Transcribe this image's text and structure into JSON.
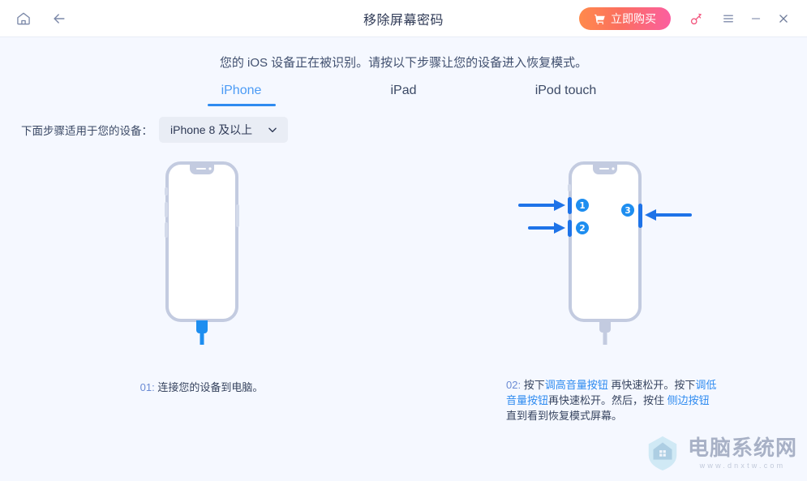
{
  "window": {
    "title": "移除屏幕密码",
    "home_icon": "home-icon",
    "back_icon": "back-arrow-icon",
    "buy_label": "立即购买",
    "cart_icon": "cart-icon",
    "key_icon": "key-icon",
    "menu_icon": "hamburger-menu-icon",
    "minimize_icon": "minimize-icon",
    "close_icon": "close-icon"
  },
  "main": {
    "subtitle": "您的 iOS 设备正在被识别。请按以下步骤让您的设备进入恢复模式。",
    "tabs": [
      {
        "label": "iPhone",
        "active": true
      },
      {
        "label": "iPad",
        "active": false
      },
      {
        "label": "iPod touch",
        "active": false
      }
    ],
    "select_label": "下面步骤适用于您的设备：",
    "select_value": "iPhone 8 及以上",
    "select_chevron": "chevron-down-icon"
  },
  "steps": [
    {
      "number": "01:",
      "text": "连接您的设备到电脑。",
      "device_image": "iphone-with-lightning-cable"
    },
    {
      "number": "02:",
      "text_parts": [
        {
          "t": "按下",
          "hl": false
        },
        {
          "t": "调高音量按钮",
          "hl": true
        },
        {
          "t": " 再快速松开。按下",
          "hl": false
        },
        {
          "t": "调低音量按钮",
          "hl": true
        },
        {
          "t": "再快速松开。然后，按住 ",
          "hl": false
        },
        {
          "t": "侧边按钮",
          "hl": true
        },
        {
          "t": "直到看到恢复模式屏幕。",
          "hl": false
        }
      ],
      "device_image": "iphone-with-button-callouts",
      "badges": [
        "1",
        "2",
        "3"
      ]
    }
  ],
  "watermark": {
    "main": "电脑系统网",
    "sub": "www.dnxtw.com",
    "logo": "house-shield-logo"
  },
  "colors": {
    "accent_blue": "#2f8bf0",
    "tab_active": "#4b9bf5",
    "buy_gradient_start": "#ff8a4c",
    "buy_gradient_end": "#fb5fa0",
    "key_pink": "#f2567e",
    "page_bg": "#f5f8ff",
    "titlebar_bg": "#ffffff",
    "phone_gray": "#c3cbe0",
    "text_dark": "#2f3a56"
  }
}
